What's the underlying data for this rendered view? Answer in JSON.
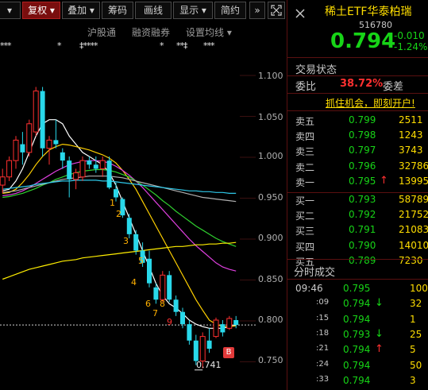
{
  "toolbar": {
    "items": [
      "复权 ▾",
      "叠加 ▾",
      "筹码",
      "画线",
      "显示 ▾",
      "简约",
      "»"
    ],
    "first_partial": "▾"
  },
  "subbar": [
    "沪股通",
    "融资融券",
    "设置均线 ▾"
  ],
  "stars": [
    "***",
    "*",
    "‡****",
    "*",
    "**‡",
    "***"
  ],
  "price_axis": [
    "1.100",
    "1.050",
    "1.000",
    "0.950",
    "0.900",
    "0.850",
    "0.800",
    "0.750"
  ],
  "wave_labels": [
    "1",
    "2",
    "3",
    "4",
    "5",
    "6",
    "7",
    "8",
    "9"
  ],
  "low_label": "0.741",
  "b_badge": "B",
  "quote": {
    "title": "稀土ETF华泰柏瑞",
    "code": "516780",
    "price": "0.794",
    "change": "-0.010",
    "change_pct": "-1.24%",
    "trade_status_label": "交易状态",
    "ratio_label": "委比",
    "ratio_value": "38.72%",
    "diff_label": "委差",
    "promo": "抓住机会，即刻开户!"
  },
  "order_book": {
    "sells": [
      {
        "name": "卖五",
        "price": "0.799",
        "vol": "2511"
      },
      {
        "name": "卖四",
        "price": "0.798",
        "vol": "1243"
      },
      {
        "name": "卖三",
        "price": "0.797",
        "vol": "3743"
      },
      {
        "name": "卖二",
        "price": "0.796",
        "vol": "32786"
      },
      {
        "name": "卖一",
        "price": "0.795",
        "vol": "13995",
        "arrow": "↑"
      }
    ],
    "buys": [
      {
        "name": "买一",
        "price": "0.793",
        "vol": "58789"
      },
      {
        "name": "买二",
        "price": "0.792",
        "vol": "21752"
      },
      {
        "name": "买三",
        "price": "0.791",
        "vol": "21083"
      },
      {
        "name": "买四",
        "price": "0.790",
        "vol": "14010"
      },
      {
        "name": "买五",
        "price": "0.789",
        "vol": "7230"
      }
    ]
  },
  "trades": {
    "header": "分时成交",
    "rows": [
      {
        "time": "09:46",
        "price": "0.795",
        "arrow": "",
        "vol": "100"
      },
      {
        "time": ":09",
        "price": "0.794",
        "arrow": "↓",
        "vol": "32"
      },
      {
        "time": ":15",
        "price": "0.794",
        "arrow": "",
        "vol": "1"
      },
      {
        "time": ":18",
        "price": "0.793",
        "arrow": "↓",
        "vol": "25"
      },
      {
        "time": ":21",
        "price": "0.794",
        "arrow": "↑",
        "vol": "5"
      },
      {
        "time": ":24",
        "price": "0.794",
        "arrow": "",
        "vol": "50"
      },
      {
        "time": ":33",
        "price": "0.794",
        "arrow": "",
        "vol": "3"
      }
    ]
  },
  "colors": {
    "up": "#ff3030",
    "down": "#17d417",
    "accent": "#ffde00",
    "bg": "#000000"
  },
  "icons": [
    "fullscreen-icon",
    "close-icon"
  ],
  "candles": [
    {
      "o": 0.965,
      "h": 0.985,
      "l": 0.955,
      "c": 0.975
    },
    {
      "o": 0.975,
      "h": 1.0,
      "l": 0.97,
      "c": 0.995
    },
    {
      "o": 0.995,
      "h": 1.025,
      "l": 0.985,
      "c": 1.02
    },
    {
      "o": 1.015,
      "h": 1.03,
      "l": 0.99,
      "c": 1.005
    },
    {
      "o": 1.005,
      "h": 1.045,
      "l": 1.0,
      "c": 1.04
    },
    {
      "o": 1.03,
      "h": 1.085,
      "l": 1.025,
      "c": 1.08
    },
    {
      "o": 1.08,
      "h": 1.085,
      "l": 1.0,
      "c": 1.01
    },
    {
      "o": 1.01,
      "h": 1.025,
      "l": 0.99,
      "c": 1.02
    },
    {
      "o": 1.02,
      "h": 1.045,
      "l": 1.01,
      "c": 1.015
    },
    {
      "o": 1.005,
      "h": 1.01,
      "l": 0.985,
      "c": 0.995
    },
    {
      "o": 0.995,
      "h": 1.0,
      "l": 0.95,
      "c": 0.972
    },
    {
      "o": 0.972,
      "h": 0.985,
      "l": 0.96,
      "c": 0.98
    },
    {
      "o": 0.975,
      "h": 1.0,
      "l": 0.97,
      "c": 0.995
    },
    {
      "o": 0.995,
      "h": 1.0,
      "l": 0.985,
      "c": 0.99
    },
    {
      "o": 0.99,
      "h": 1.0,
      "l": 0.98,
      "c": 0.985
    },
    {
      "o": 0.985,
      "h": 1.0,
      "l": 0.975,
      "c": 0.995
    },
    {
      "o": 0.995,
      "h": 1.0,
      "l": 0.96,
      "c": 0.962
    },
    {
      "o": 0.96,
      "h": 0.968,
      "l": 0.945,
      "c": 0.95
    },
    {
      "o": 0.948,
      "h": 0.95,
      "l": 0.925,
      "c": 0.928
    },
    {
      "o": 0.925,
      "h": 0.93,
      "l": 0.9,
      "c": 0.905
    },
    {
      "o": 0.905,
      "h": 0.91,
      "l": 0.88,
      "c": 0.885
    },
    {
      "o": 0.885,
      "h": 0.895,
      "l": 0.865,
      "c": 0.87
    },
    {
      "o": 0.875,
      "h": 0.885,
      "l": 0.84,
      "c": 0.845
    },
    {
      "o": 0.84,
      "h": 0.845,
      "l": 0.82,
      "c": 0.825
    },
    {
      "o": 0.825,
      "h": 0.86,
      "l": 0.822,
      "c": 0.855
    },
    {
      "o": 0.855,
      "h": 0.86,
      "l": 0.822,
      "c": 0.825
    },
    {
      "o": 0.825,
      "h": 0.83,
      "l": 0.805,
      "c": 0.81
    },
    {
      "o": 0.81,
      "h": 0.815,
      "l": 0.79,
      "c": 0.795
    },
    {
      "o": 0.795,
      "h": 0.8,
      "l": 0.77,
      "c": 0.775
    },
    {
      "o": 0.775,
      "h": 0.782,
      "l": 0.745,
      "c": 0.75
    },
    {
      "o": 0.75,
      "h": 0.785,
      "l": 0.741,
      "c": 0.78
    },
    {
      "o": 0.775,
      "h": 0.79,
      "l": 0.76,
      "c": 0.765
    },
    {
      "o": 0.78,
      "h": 0.803,
      "l": 0.778,
      "c": 0.8
    },
    {
      "o": 0.795,
      "h": 0.8,
      "l": 0.78,
      "c": 0.785
    },
    {
      "o": 0.79,
      "h": 0.805,
      "l": 0.788,
      "c": 0.802
    },
    {
      "o": 0.8,
      "h": 0.805,
      "l": 0.79,
      "c": 0.794
    }
  ],
  "ma": [
    {
      "color": "#ffffff",
      "pts": [
        0.958,
        0.96,
        0.97,
        0.985,
        1.005,
        1.025,
        1.04,
        1.045,
        1.045,
        1.04,
        1.025,
        1.015,
        1.005,
        1.0,
        0.995,
        0.99,
        0.98,
        0.965,
        0.945,
        0.925,
        0.905,
        0.885,
        0.865,
        0.845,
        0.83,
        0.82,
        0.815,
        0.808,
        0.8,
        0.795,
        0.792,
        0.79,
        0.79,
        0.79,
        0.792,
        0.794
      ]
    },
    {
      "color": "#ffd000",
      "pts": [
        0.955,
        0.956,
        0.96,
        0.968,
        0.978,
        0.99,
        1.0,
        1.008,
        1.012,
        1.015,
        1.014,
        1.012,
        1.01,
        1.008,
        1.005,
        1.002,
        0.998,
        0.992,
        0.983,
        0.972,
        0.96,
        0.945,
        0.93,
        0.915,
        0.9,
        0.885,
        0.87,
        0.855,
        0.84,
        0.825,
        0.812,
        0.8,
        0.795,
        0.792,
        0.792,
        0.793
      ]
    },
    {
      "color": "#e040e0",
      "pts": [
        0.952,
        0.953,
        0.955,
        0.958,
        0.962,
        0.967,
        0.972,
        0.977,
        0.982,
        0.986,
        0.99,
        0.992,
        0.994,
        0.995,
        0.995,
        0.994,
        0.992,
        0.988,
        0.983,
        0.977,
        0.97,
        0.962,
        0.953,
        0.944,
        0.935,
        0.926,
        0.917,
        0.908,
        0.899,
        0.891,
        0.884,
        0.877,
        0.87,
        0.865,
        0.862,
        0.86
      ]
    },
    {
      "color": "#2fd02f",
      "pts": [
        0.95,
        0.951,
        0.953,
        0.955,
        0.958,
        0.961,
        0.965,
        0.968,
        0.972,
        0.975,
        0.978,
        0.98,
        0.982,
        0.983,
        0.984,
        0.984,
        0.983,
        0.981,
        0.978,
        0.975,
        0.97,
        0.965,
        0.959,
        0.953,
        0.946,
        0.94,
        0.933,
        0.927,
        0.921,
        0.915,
        0.91,
        0.905,
        0.9,
        0.896,
        0.893,
        0.89
      ]
    },
    {
      "color": "#b0b0b0",
      "pts": [
        0.956,
        0.957,
        0.958,
        0.96,
        0.962,
        0.964,
        0.966,
        0.968,
        0.97,
        0.972,
        0.973,
        0.974,
        0.975,
        0.976,
        0.976,
        0.976,
        0.976,
        0.975,
        0.974,
        0.972,
        0.97,
        0.968,
        0.966,
        0.964,
        0.962,
        0.96,
        0.958,
        0.956,
        0.954,
        0.952,
        0.95,
        0.949,
        0.948,
        0.947,
        0.946,
        0.945
      ]
    },
    {
      "color": "#2ec8e8",
      "pts": [
        0.96,
        0.961,
        0.962,
        0.963,
        0.964,
        0.966,
        0.967,
        0.968,
        0.969,
        0.97,
        0.97,
        0.971,
        0.971,
        0.971,
        0.971,
        0.97,
        0.97,
        0.969,
        0.968,
        0.967,
        0.966,
        0.965,
        0.964,
        0.963,
        0.962,
        0.961,
        0.96,
        0.959,
        0.958,
        0.958,
        0.957,
        0.957,
        0.956,
        0.956,
        0.955,
        0.955
      ]
    },
    {
      "color": "#ffee00",
      "pts": [
        0.85,
        0.853,
        0.856,
        0.859,
        0.862,
        0.864,
        0.866,
        0.868,
        0.87,
        0.872,
        0.873,
        0.874,
        0.876,
        0.877,
        0.878,
        0.879,
        0.88,
        0.881,
        0.882,
        0.883,
        0.884,
        0.885,
        0.886,
        0.887,
        0.888,
        0.889,
        0.89,
        0.89,
        0.891,
        0.892,
        0.892,
        0.893,
        0.893,
        0.894,
        0.894,
        0.895
      ]
    }
  ]
}
